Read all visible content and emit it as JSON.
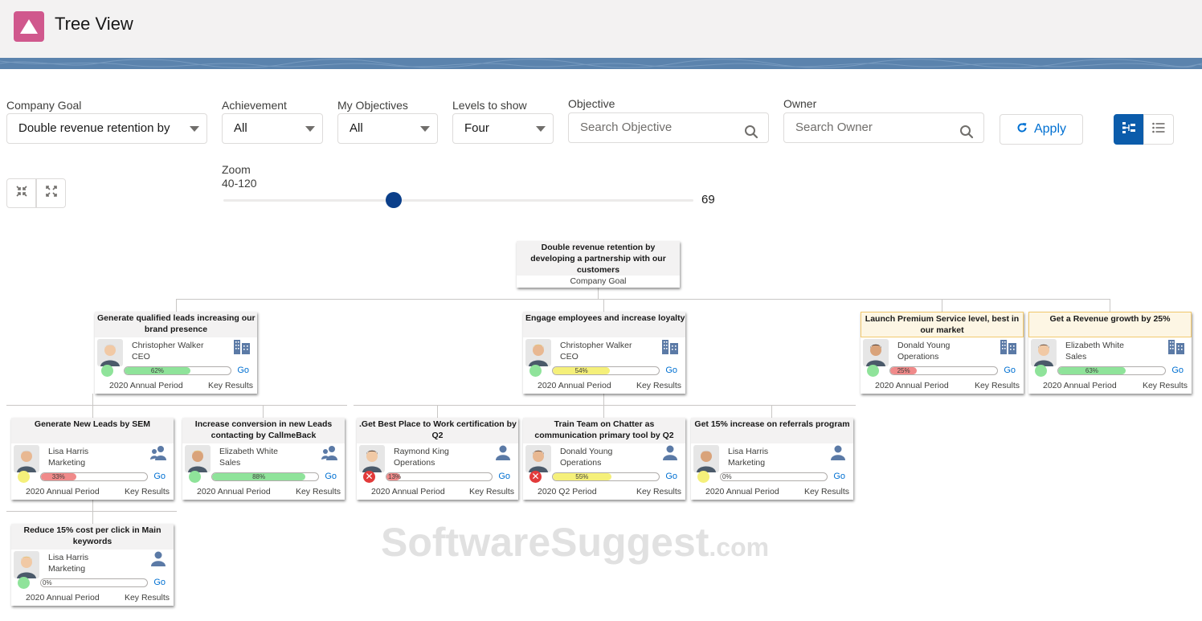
{
  "app": {
    "title": "Tree View"
  },
  "filters": {
    "company_goal": {
      "label": "Company Goal",
      "value": "Double revenue retention by"
    },
    "achievement": {
      "label": "Achievement",
      "value": "All"
    },
    "my_objectives": {
      "label": "My Objectives",
      "value": "All"
    },
    "levels": {
      "label": "Levels to show",
      "value": "Four"
    },
    "objective": {
      "label": "Objective",
      "placeholder": "Search Objective"
    },
    "owner": {
      "label": "Owner",
      "placeholder": "Search Owner"
    },
    "apply_label": "Apply"
  },
  "view_toggle": {
    "active": "tree",
    "icons": [
      "tree-view-icon",
      "list-view-icon"
    ]
  },
  "tools": {
    "icons": [
      "collapse-all-icon",
      "expand-all-icon"
    ]
  },
  "zoom": {
    "label": "Zoom",
    "range": "40-120",
    "min": 40,
    "max": 120,
    "value": 69,
    "value_text": "69"
  },
  "colors": {
    "accent": "#0b5cab",
    "brand": "#d0588d",
    "link": "#0070d2",
    "green": "#8fe39a",
    "red": "#e23a3a",
    "yellow": "#f5f07a"
  },
  "root": {
    "title_lines": [
      "Double revenue retention by",
      "developing a partnership with our",
      "customers"
    ],
    "subtitle": "Company Goal"
  },
  "go_label": "Go",
  "key_results_label": "Key Results",
  "cards": [
    {
      "id": "c1",
      "title_lines": [
        "Generate qualified leads increasing our",
        "brand presence"
      ],
      "owner": "Christopher Walker",
      "role": "CEO",
      "type": "company",
      "status": "green",
      "progress": 0.62,
      "progress_text": "62%",
      "period": "2020 Annual Period"
    },
    {
      "id": "c2",
      "title_lines": [
        "Engage employees and increase loyalty"
      ],
      "owner": "Christopher Walker",
      "role": "CEO",
      "type": "company",
      "status": "green",
      "progress": 0.54,
      "progress_text": "54%",
      "period": "2020 Annual Period"
    },
    {
      "id": "c3",
      "title_lines": [
        "Launch Premium Service level, best in",
        "our market"
      ],
      "owner": "Donald Young",
      "role": "Operations",
      "type": "company",
      "status": "green",
      "progress": 0.25,
      "progress_text": "25%",
      "period": "2020 Annual Period"
    },
    {
      "id": "c4",
      "title_lines": [
        "Get a Revenue growth by 25%"
      ],
      "owner": "Elizabeth White",
      "role": "Sales",
      "type": "company",
      "status": "green",
      "progress": 0.63,
      "progress_text": "63%",
      "period": "2020 Annual Period"
    },
    {
      "id": "c5",
      "title_lines": [
        "Generate New Leads by SEM"
      ],
      "owner": "Lisa Harris",
      "role": "Marketing",
      "type": "team",
      "status": "yellow",
      "progress": 0.33,
      "progress_text": "33%",
      "period": "2020 Annual Period"
    },
    {
      "id": "c6",
      "title_lines": [
        "Increase conversion in new Leads",
        "contacting by CallmeBack"
      ],
      "owner": "Elizabeth White",
      "role": "Sales",
      "type": "team",
      "status": "green",
      "progress": 0.88,
      "progress_text": "88%",
      "period": "2020 Annual Period"
    },
    {
      "id": "c7",
      "title_lines": [
        ".Get Best Place to Work certification by",
        "Q2"
      ],
      "owner": "Raymond King",
      "role": "Operations",
      "type": "person",
      "status": "red",
      "progress": 0.13,
      "progress_text": "13%",
      "period": "2020 Annual Period"
    },
    {
      "id": "c8",
      "title_lines": [
        "Train Team on Chatter as",
        "communication primary tool by Q2"
      ],
      "owner": "Donald Young",
      "role": "Operations",
      "type": "person",
      "status": "red",
      "progress": 0.55,
      "progress_text": "55%",
      "period": "2020 Q2 Period"
    },
    {
      "id": "c9",
      "title_lines": [
        "Get 15% increase on referrals program"
      ],
      "owner": "Lisa Harris",
      "role": "Marketing",
      "type": "person",
      "status": "yellow",
      "progress": 0.0,
      "progress_text": "0%",
      "period": "2020 Annual Period"
    },
    {
      "id": "c10",
      "title_lines": [
        "Reduce 15% cost per click in Main",
        "keywords"
      ],
      "owner": "Lisa Harris",
      "role": "Marketing",
      "type": "person",
      "status": "green",
      "progress": 0.0,
      "progress_text": "0%",
      "period": "2020 Annual Period"
    }
  ],
  "watermark": {
    "main": "SoftwareSuggest",
    "suffix": ".com"
  }
}
